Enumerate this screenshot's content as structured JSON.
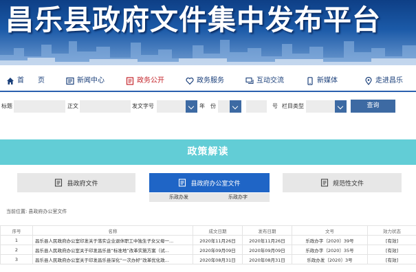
{
  "banner": {
    "title": "昌乐县政府文件集中发布平台"
  },
  "nav": [
    {
      "label": "首　　页",
      "icon": "home-icon"
    },
    {
      "label": "新闻中心",
      "icon": "news-icon"
    },
    {
      "label": "政务公开",
      "icon": "document-icon",
      "active": true
    },
    {
      "label": "政务服务",
      "icon": "heart-icon"
    },
    {
      "label": "互动交流",
      "icon": "chat-icon"
    },
    {
      "label": "新媒体",
      "icon": "phone-icon"
    },
    {
      "label": "走进昌乐",
      "icon": "location-icon"
    }
  ],
  "search": {
    "title_label": "标题",
    "title_value": "",
    "body_label": "正文",
    "body_value": "",
    "docnum_label": "发文字号",
    "docnum_value": "",
    "year_label": "年　份",
    "year_value": "",
    "num_label": "号",
    "num_value": "",
    "column_label": "栏目类型",
    "column_value": "",
    "query_button": "查询"
  },
  "policy": {
    "heading": "政策解读",
    "categories": [
      {
        "label": "县政府文件",
        "icon": "file-icon"
      },
      {
        "label": "县政府办公室文件",
        "icon": "file-icon",
        "active": true
      },
      {
        "label": "规范性文件",
        "icon": "file-icon"
      }
    ],
    "sub_tabs": [
      "乐政办发",
      "乐政办字"
    ]
  },
  "breadcrumb": {
    "label": "当前位置:",
    "current": "县政府办公室文件"
  },
  "table": {
    "headers": [
      "序号",
      "名称",
      "成文日期",
      "发布日期",
      "文号",
      "效力状态"
    ],
    "rows": [
      {
        "no": "1",
        "name": "昌乐县人民政府办公室印发关于落实企业退休职工中独生子女父母一...",
        "written": "2020年11月26日",
        "published": "2020年11月26日",
        "docnum": "乐政办字〔2020〕39号",
        "status": "[有效]"
      },
      {
        "no": "2",
        "name": "昌乐县人民政府办公室关于印发昌乐县“标准地”改革实施方案（试...",
        "written": "2020年09月09日",
        "published": "2020年09月09日",
        "docnum": "乐政办字〔2020〕35号",
        "status": "[有效]"
      },
      {
        "no": "3",
        "name": "昌乐县人民政府办公室关于印发昌乐县深化“一次办好”改革优化政...",
        "written": "2020年08月31日",
        "published": "2020年08月31日",
        "docnum": "乐政办发〔2020〕3号",
        "status": "[有效]"
      }
    ]
  },
  "colors": {
    "banner": "#1b5aa8",
    "nav_active": "#c4252b",
    "policy_bar": "#62cdd6",
    "active_category": "#1f65c6",
    "button": "#3d6aa3"
  }
}
